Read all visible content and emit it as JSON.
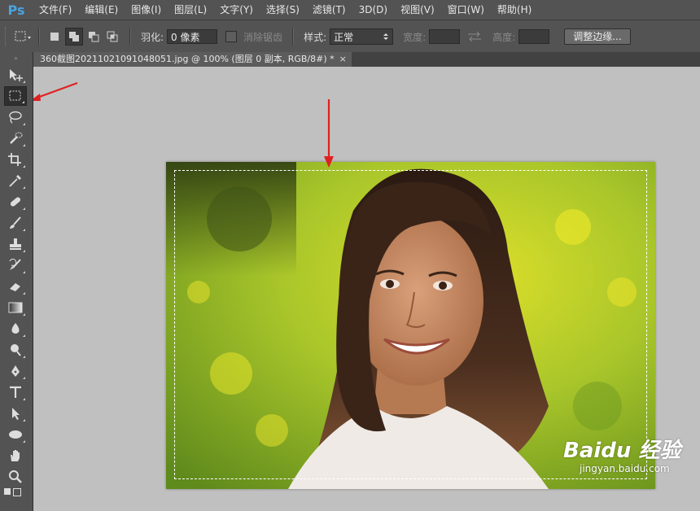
{
  "app": {
    "logo_text": "Ps"
  },
  "menu": [
    "文件(F)",
    "编辑(E)",
    "图像(I)",
    "图层(L)",
    "文字(Y)",
    "选择(S)",
    "滤镜(T)",
    "3D(D)",
    "视图(V)",
    "窗口(W)",
    "帮助(H)"
  ],
  "options": {
    "feather_label": "羽化:",
    "feather_value": "0 像素",
    "antialias_label": "消除锯齿",
    "style_label": "样式:",
    "style_value": "正常",
    "width_label": "宽度:",
    "height_label": "高度:",
    "refine_edge_label": "调整边缘..."
  },
  "document": {
    "tab_title": "360截图20211021091048051.jpg @ 100% (图层 0 副本, RGB/8#) *",
    "close_glyph": "×"
  },
  "watermark": {
    "brand": "Baidu 经验",
    "sub": "jingyan.baidu.com"
  },
  "annotations": {
    "arrow_color": "#e02020"
  },
  "colors": {
    "accent": "#4aa3df",
    "canvas_bg": "#c0c0c0",
    "ui_bg": "#535353"
  },
  "tools": [
    "move-icon",
    "rectangular-marquee-icon",
    "lasso-icon",
    "quick-selection-icon",
    "crop-icon",
    "eyedropper-icon",
    "spot-healing-icon",
    "brush-icon",
    "clone-stamp-icon",
    "history-brush-icon",
    "eraser-icon",
    "gradient-icon",
    "blur-icon",
    "dodge-icon",
    "pen-icon",
    "type-icon",
    "path-selection-icon",
    "ellipse-icon",
    "hand-icon",
    "zoom-icon"
  ]
}
